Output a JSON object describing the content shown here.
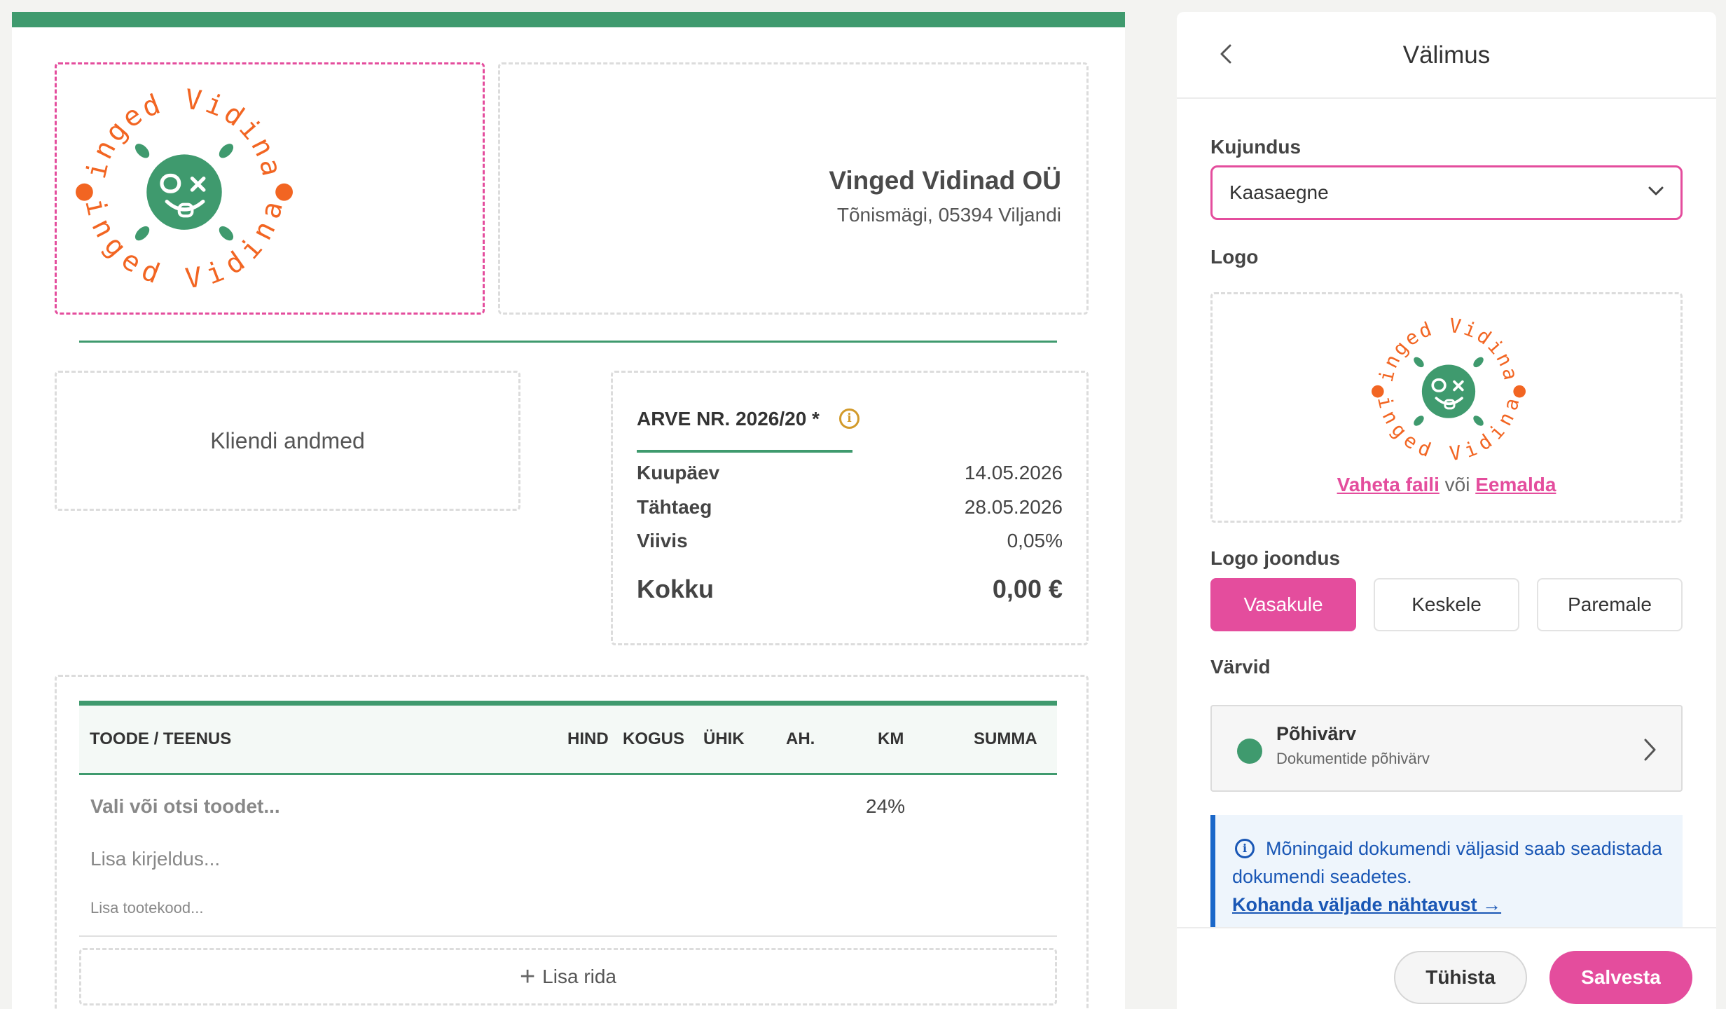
{
  "colors": {
    "accent": "#e44d9d",
    "brand_green": "#3f9a6e",
    "logo_orange": "#f26522",
    "info_blue": "#1a57b5"
  },
  "document": {
    "logo": {
      "ring_text": "Vinged Vidinad"
    },
    "company": {
      "name": "Vinged Vidinad OÜ",
      "address": "Tõnismägi, 05394 Viljandi"
    },
    "client_placeholder": "Kliendi andmed",
    "invoice": {
      "title": "ARVE NR. 2026/20 *",
      "info_icon": "info-icon",
      "rows": [
        {
          "label": "Kuupäev",
          "value": "14.05.2026"
        },
        {
          "label": "Tähtaeg",
          "value": "28.05.2026"
        },
        {
          "label": "Viivis",
          "value": "0,05%"
        }
      ],
      "total_label": "Kokku",
      "total_value": "0,00 €"
    },
    "table": {
      "columns": [
        "TOODE / TEENUS",
        "HIND",
        "KOGUS",
        "ÜHIK",
        "AH.",
        "KM",
        "SUMMA"
      ],
      "product_placeholder": "Vali või otsi toodet...",
      "vat": "24%",
      "description_placeholder": "Lisa kirjeldus...",
      "code_placeholder": "Lisa tootekood...",
      "add_row_label": "Lisa rida"
    }
  },
  "panel": {
    "title": "Välimus",
    "design_label": "Kujundus",
    "design_value": "Kaasaegne",
    "logo_label": "Logo",
    "logo_change": "Vaheta faili",
    "logo_or": " või ",
    "logo_remove": "Eemalda",
    "alignment_label": "Logo joondus",
    "alignment_options": [
      "Vasakule",
      "Keskele",
      "Paremale"
    ],
    "alignment_selected": "Vasakule",
    "colors_label": "Värvid",
    "primary_color_title": "Põhivärv",
    "primary_color_subtitle": "Dokumentide põhivärv",
    "info_text": "Mõningaid dokumendi väljasid saab seadistada dokumendi seadetes.",
    "info_link": "Kohanda väljade nähtavust →",
    "cancel": "Tühista",
    "save": "Salvesta"
  }
}
